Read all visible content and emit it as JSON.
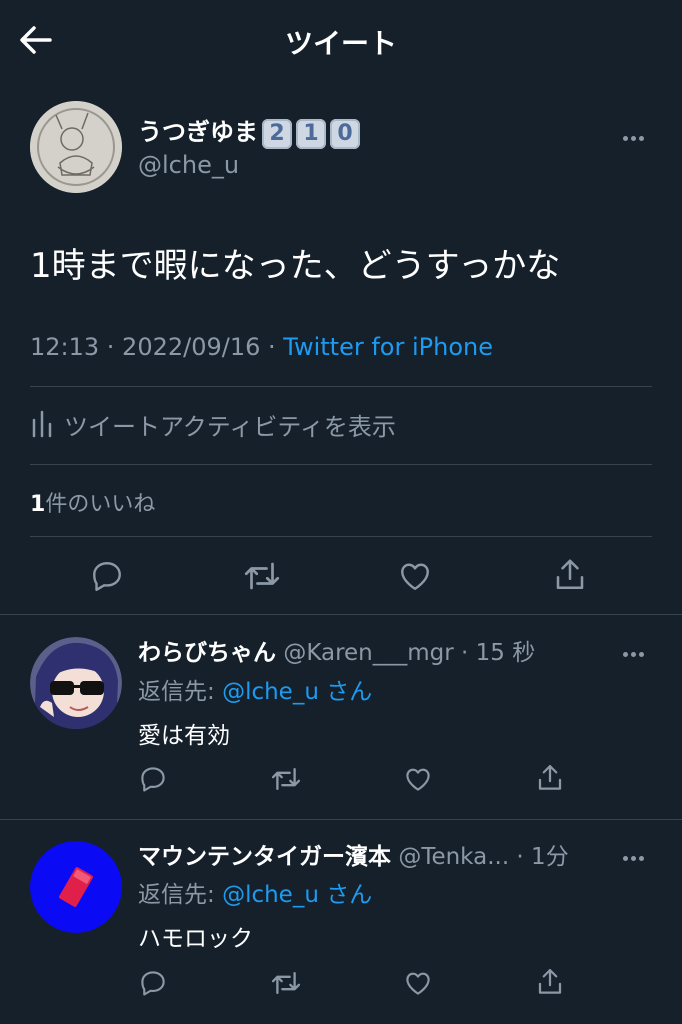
{
  "header": {
    "title": "ツイート"
  },
  "main_tweet": {
    "display_name": "うつぎゆま",
    "badges": [
      "2",
      "1",
      "0"
    ],
    "handle": "@lche_u",
    "text": "1時まで暇になった、どうすっかな",
    "time": "12:13 · 2022/09/16 · ",
    "source": "Twitter for iPhone",
    "activity_label": "ツイートアクティビティを表示",
    "likes_count": "1",
    "likes_label": "件のいいね"
  },
  "replies": [
    {
      "display_name": "わらびちゃん",
      "handle_time": "@Karen___mgr · 15 秒",
      "reply_prefix": "返信先: ",
      "reply_handle": "@lche_u",
      "reply_suffix": " さん",
      "text": "愛は有効"
    },
    {
      "display_name": "マウンテンタイガー濱本",
      "handle_time": "@Tenka... · 1分",
      "reply_prefix": "返信先: ",
      "reply_handle": "@lche_u",
      "reply_suffix": " さん",
      "text": "ハモロック"
    }
  ],
  "colors": {
    "background": "#15202b",
    "accent": "#1d9bf0",
    "muted": "#8b98a5",
    "divider": "#38444d"
  },
  "icons": [
    "back-arrow-icon",
    "more-icon",
    "activity-icon",
    "reply-icon",
    "retweet-icon",
    "like-icon",
    "share-icon"
  ]
}
